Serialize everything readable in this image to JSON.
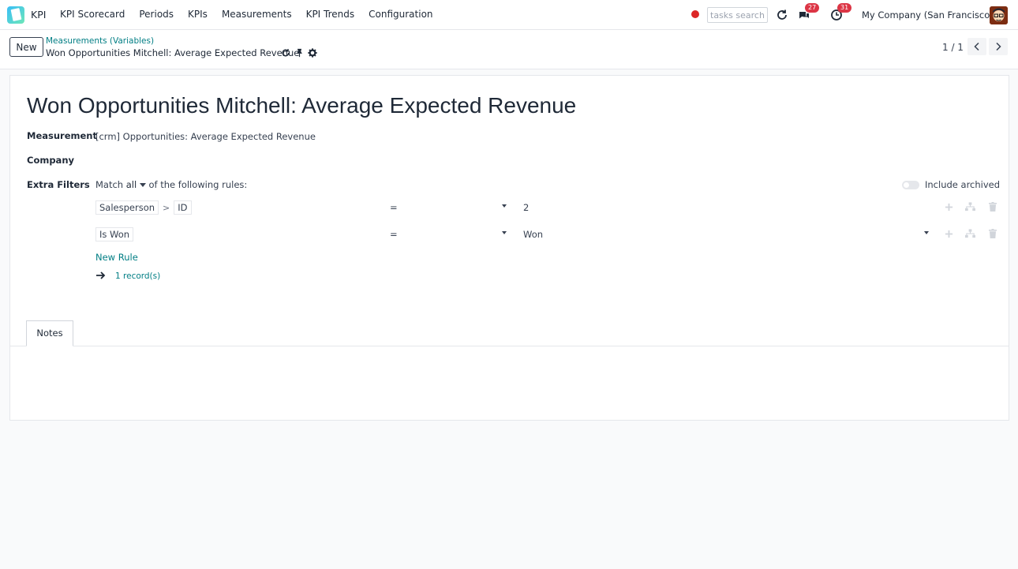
{
  "navbar": {
    "app_name": "KPI",
    "menu": [
      "KPI Scorecard",
      "Periods",
      "KPIs",
      "Measurements",
      "KPI Trends",
      "Configuration"
    ],
    "search_placeholder": "tasks search",
    "messages_count": "27",
    "activities_count": "31",
    "company": "My Company (San Francisco)"
  },
  "control": {
    "new_label": "New",
    "breadcrumb_parent": "Measurements (Variables)",
    "breadcrumb_current": "Won Opportunities Mitchell: Average Expected Revenue",
    "pager": "1 / 1"
  },
  "form": {
    "title": "Won Opportunities Mitchell: Average Expected Revenue",
    "measurement_label": "Measurement",
    "measurement_value": "[crm] Opportunities: Average Expected Revenue",
    "company_label": "Company",
    "extra_filters_label": "Extra Filters",
    "match_prefix": "Match",
    "match_mode": "all",
    "match_suffix": "of the following rules:",
    "include_archived_label": "Include archived",
    "rules": [
      {
        "path": [
          "Salesperson",
          "ID"
        ],
        "operator": "=",
        "value": "2"
      },
      {
        "path": [
          "Is Won"
        ],
        "operator": "=",
        "value": "Won"
      }
    ],
    "new_rule_label": "New Rule",
    "records_label": "1 record(s)"
  },
  "tabs": {
    "notes_label": "Notes"
  },
  "colors": {
    "link": "#017e84",
    "badge": "#dc3545",
    "record_dot": "#dc2626"
  }
}
